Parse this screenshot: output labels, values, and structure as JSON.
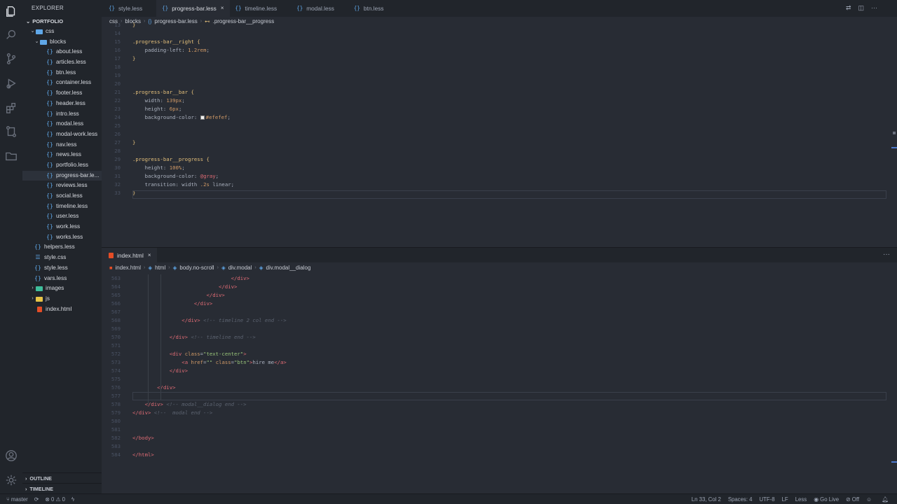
{
  "sidebar": {
    "title": "EXPLORER",
    "section": "PORTFOLIO",
    "tree": [
      {
        "label": "css",
        "type": "folder",
        "depth": 1,
        "open": true,
        "color": "#5fa7e8"
      },
      {
        "label": "blocks",
        "type": "folder",
        "depth": 2,
        "open": true,
        "color": "#5fa7e8"
      },
      {
        "label": "about.less",
        "type": "less",
        "depth": 3
      },
      {
        "label": "articles.less",
        "type": "less",
        "depth": 3
      },
      {
        "label": "btn.less",
        "type": "less",
        "depth": 3
      },
      {
        "label": "container.less",
        "type": "less",
        "depth": 3
      },
      {
        "label": "footer.less",
        "type": "less",
        "depth": 3
      },
      {
        "label": "header.less",
        "type": "less",
        "depth": 3
      },
      {
        "label": "intro.less",
        "type": "less",
        "depth": 3
      },
      {
        "label": "modal.less",
        "type": "less",
        "depth": 3
      },
      {
        "label": "modal-work.less",
        "type": "less",
        "depth": 3
      },
      {
        "label": "nav.less",
        "type": "less",
        "depth": 3
      },
      {
        "label": "news.less",
        "type": "less",
        "depth": 3
      },
      {
        "label": "portfolio.less",
        "type": "less",
        "depth": 3
      },
      {
        "label": "progress-bar.le...",
        "type": "less",
        "depth": 3,
        "selected": true
      },
      {
        "label": "reviews.less",
        "type": "less",
        "depth": 3
      },
      {
        "label": "social.less",
        "type": "less",
        "depth": 3
      },
      {
        "label": "timeline.less",
        "type": "less",
        "depth": 3
      },
      {
        "label": "user.less",
        "type": "less",
        "depth": 3
      },
      {
        "label": "work.less",
        "type": "less",
        "depth": 3
      },
      {
        "label": "works.less",
        "type": "less",
        "depth": 3
      },
      {
        "label": "helpers.less",
        "type": "less",
        "depth": 2
      },
      {
        "label": "style.css",
        "type": "css",
        "depth": 2
      },
      {
        "label": "style.less",
        "type": "less",
        "depth": 2
      },
      {
        "label": "vars.less",
        "type": "less",
        "depth": 2
      },
      {
        "label": "images",
        "type": "folder",
        "depth": 1,
        "open": false,
        "color": "#3fbf9c"
      },
      {
        "label": "js",
        "type": "folder",
        "depth": 1,
        "open": false,
        "color": "#e8c547"
      },
      {
        "label": "index.html",
        "type": "html",
        "depth": 1
      }
    ],
    "outline_label": "OUTLINE",
    "timeline_label": "TIMELINE"
  },
  "tabs": [
    {
      "label": "style.less",
      "active": false
    },
    {
      "label": "progress-bar.less",
      "active": true,
      "close": "×"
    },
    {
      "label": "timeline.less",
      "active": false
    },
    {
      "label": "modal.less",
      "active": false
    },
    {
      "label": "btn.less",
      "active": false
    }
  ],
  "breadcrumb_top": [
    "css",
    "blocks",
    "progress-bar.less",
    ".progress-bar__progress"
  ],
  "code_top": [
    {
      "n": "13",
      "html": "<span class='t-brace'>}</span>"
    },
    {
      "n": "14",
      "html": ""
    },
    {
      "n": "15",
      "html": "<span class='t-sel'>.progress-bar__right</span> <span class='t-brace'>{</span>"
    },
    {
      "n": "16",
      "html": "    <span class='t-prop'>padding-left:</span> <span class='t-num'>1.2rem</span>;"
    },
    {
      "n": "17",
      "html": "<span class='t-brace'>}</span>"
    },
    {
      "n": "18",
      "html": ""
    },
    {
      "n": "19",
      "html": ""
    },
    {
      "n": "20",
      "html": ""
    },
    {
      "n": "21",
      "html": "<span class='t-sel'>.progress-bar__bar</span> <span class='t-brace'>{</span>"
    },
    {
      "n": "22",
      "html": "    <span class='t-prop'>width:</span> <span class='t-num'>139px</span>;"
    },
    {
      "n": "23",
      "html": "    <span class='t-prop'>height:</span> <span class='t-num'>6px</span>;"
    },
    {
      "n": "24",
      "html": "    <span class='t-prop'>background-color:</span> <span class='swatch'></span><span class='t-num'>#efefef</span>;"
    },
    {
      "n": "25",
      "html": ""
    },
    {
      "n": "26",
      "html": ""
    },
    {
      "n": "27",
      "html": "<span class='t-brace'>}</span>"
    },
    {
      "n": "28",
      "html": ""
    },
    {
      "n": "29",
      "html": "<span class='t-sel'>.progress-bar__progress</span> <span class='t-brace'>{</span>"
    },
    {
      "n": "30",
      "html": "    <span class='t-prop'>height:</span> <span class='t-num'>100%</span>;"
    },
    {
      "n": "31",
      "html": "    <span class='t-prop'>background-color:</span> <span class='t-var'>@gray</span>;"
    },
    {
      "n": "32",
      "html": "    <span class='t-prop'>transition:</span> width <span class='t-num'>.2s</span> linear;"
    },
    {
      "n": "33",
      "html": "<span class='t-brace'>}</span>"
    }
  ],
  "panel2_tab": {
    "label": "index.html",
    "close": "×"
  },
  "panel2_more": "···",
  "breadcrumb_bottom": [
    "index.html",
    "html",
    "body.no-scroll",
    "div.modal",
    "div.modal__dialog"
  ],
  "code_bottom": [
    {
      "n": "563",
      "html": "                                <span class='t-tag'>&lt;/div&gt;</span>"
    },
    {
      "n": "564",
      "html": "                            <span class='t-tag'>&lt;/div&gt;</span>"
    },
    {
      "n": "565",
      "html": "                        <span class='t-tag'>&lt;/div&gt;</span>"
    },
    {
      "n": "566",
      "html": "                    <span class='t-tag'>&lt;/div&gt;</span>"
    },
    {
      "n": "567",
      "html": ""
    },
    {
      "n": "568",
      "html": "                <span class='t-tag'>&lt;/div&gt;</span> <span class='t-com'>&lt;!-- timeline 2 col end --&gt;</span>"
    },
    {
      "n": "569",
      "html": ""
    },
    {
      "n": "570",
      "html": "            <span class='t-tag'>&lt;/div&gt;</span> <span class='t-com'>&lt;!-- timeline end --&gt;</span>"
    },
    {
      "n": "571",
      "html": ""
    },
    {
      "n": "572",
      "html": "            <span class='t-tag'>&lt;div</span> <span class='t-attr'>class</span>=<span class='t-str'>\"text-center\"</span><span class='t-tag'>&gt;</span>"
    },
    {
      "n": "573",
      "html": "                <span class='t-tag'>&lt;a</span> <span class='t-attr'>href</span>=<span class='t-str'>\"\"</span> <span class='t-attr'>class</span>=<span class='t-str'>\"btn\"</span><span class='t-tag'>&gt;</span>hire me<span class='t-tag'>&lt;/a&gt;</span>"
    },
    {
      "n": "574",
      "html": "            <span class='t-tag'>&lt;/div&gt;</span>"
    },
    {
      "n": "575",
      "html": ""
    },
    {
      "n": "576",
      "html": "        <span class='t-tag'>&lt;/div&gt;</span>"
    },
    {
      "n": "577",
      "html": ""
    },
    {
      "n": "578",
      "html": "    <span class='t-tag'>&lt;/div&gt;</span> <span class='t-com'>&lt;!-- modal__dialog end --&gt;</span>"
    },
    {
      "n": "579",
      "html": "<span class='t-tag'>&lt;/div&gt;</span> <span class='t-com'>&lt;!--  modal end --&gt;</span>"
    },
    {
      "n": "580",
      "html": ""
    },
    {
      "n": "581",
      "html": ""
    },
    {
      "n": "582",
      "html": "<span class='t-tag'>&lt;/body&gt;</span>"
    },
    {
      "n": "583",
      "html": ""
    },
    {
      "n": "584",
      "html": "<span class='t-tag'>&lt;/html&gt;</span>"
    }
  ],
  "status": {
    "branch": "master",
    "sync": "⟳",
    "problems": "⊗ 0 ⚠ 0",
    "bolt": "ϟ",
    "position": "Ln 33, Col 2",
    "spaces": "Spaces: 4",
    "encoding": "UTF-8",
    "eol": "LF",
    "language": "Less",
    "golive": "Go Live",
    "off": "Off",
    "bell": "🔔︎"
  },
  "colors": {
    "accent": "#4d78cc",
    "background": "#282c34",
    "sidebar": "#21252b"
  },
  "icons": [
    "files-icon",
    "search-icon",
    "source-control-icon",
    "run-debug-icon",
    "extensions-icon",
    "remote-icon",
    "folder-icon",
    "account-icon",
    "settings-icon"
  ]
}
